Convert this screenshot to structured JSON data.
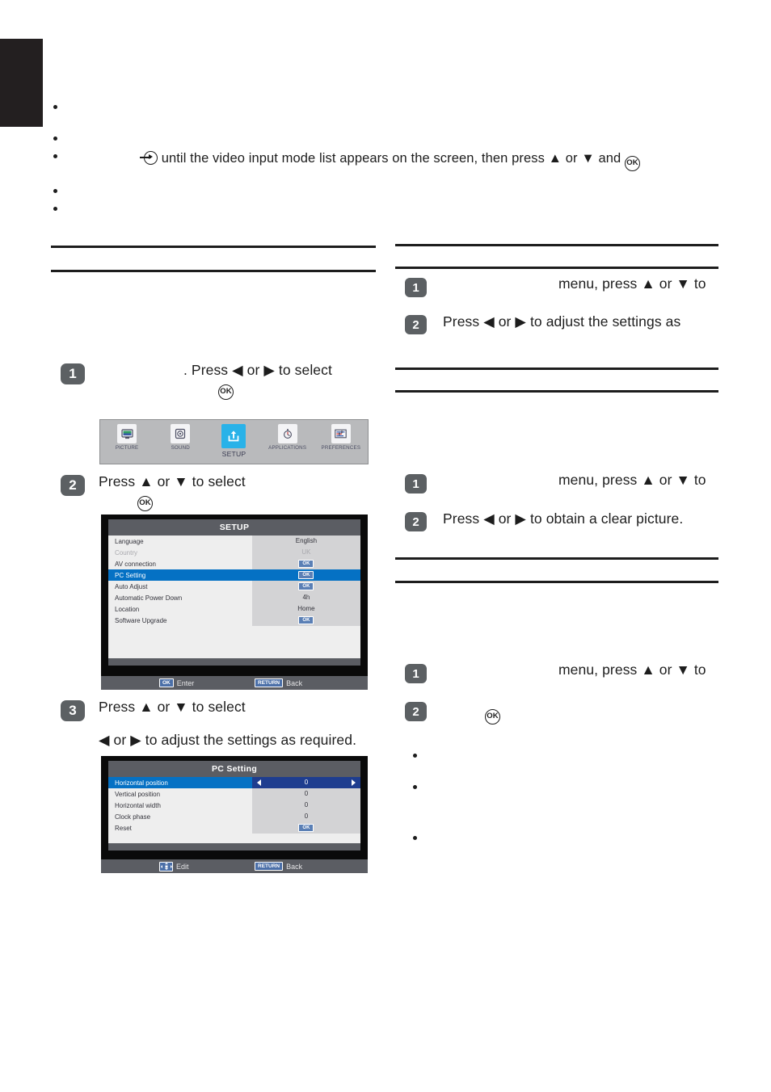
{
  "page": {
    "top_note": {
      "text_before": "until the video input mode list appears on the screen, then press ▲ or ▼ and",
      "ok_label": "OK"
    }
  },
  "left_column": {
    "steps": [
      {
        "number": "1",
        "line1": ". Press ◀ or ▶ to select",
        "line2_ok": "OK"
      },
      {
        "number": "2",
        "line1": "Press ▲ or ▼ to select",
        "line2_ok": "OK"
      },
      {
        "number": "3",
        "line1": "Press ▲ or ▼ to select",
        "line2": "◀ or ▶ to adjust the settings as required."
      }
    ],
    "icon_bar": {
      "items": [
        {
          "label": "PICTURE",
          "icon": "monitor-icon",
          "active": false
        },
        {
          "label": "SOUND",
          "icon": "speaker-icon",
          "active": false
        },
        {
          "label": "SETUP",
          "icon": "setup-upload-icon",
          "active": true
        },
        {
          "label": "APPLICATIONS",
          "icon": "stopwatch-icon",
          "active": false
        },
        {
          "label": "PREFERENCES",
          "icon": "sliders-icon",
          "active": false
        }
      ],
      "active_color": "#29b2e8"
    },
    "setup_menu": {
      "title": "SETUP",
      "rows": [
        {
          "label": "Language",
          "value": "English",
          "type": "text",
          "state": "normal"
        },
        {
          "label": "Country",
          "value": "UK",
          "type": "text",
          "state": "dim"
        },
        {
          "label": "AV connection",
          "value": "OK",
          "type": "ok",
          "state": "normal"
        },
        {
          "label": "PC Setting",
          "value": "OK",
          "type": "ok",
          "state": "selected"
        },
        {
          "label": "Auto Adjust",
          "value": "OK",
          "type": "ok",
          "state": "normal"
        },
        {
          "label": "Automatic Power Down",
          "value": "4h",
          "type": "text",
          "state": "normal"
        },
        {
          "label": "Location",
          "value": "Home",
          "type": "text",
          "state": "normal"
        },
        {
          "label": "Software Upgrade",
          "value": "OK",
          "type": "ok",
          "state": "normal"
        }
      ],
      "footer": {
        "left_key": "OK",
        "left_label": "Enter",
        "right_key": "RETURN",
        "right_label": "Back"
      }
    },
    "pc_setting_menu": {
      "title": "PC Setting",
      "rows": [
        {
          "label": "Horizontal position",
          "value": "0",
          "type": "spin",
          "state": "selected"
        },
        {
          "label": "Vertical position",
          "value": "0",
          "type": "text",
          "state": "normal"
        },
        {
          "label": "Horizontal width",
          "value": "0",
          "type": "text",
          "state": "normal"
        },
        {
          "label": "Clock phase",
          "value": "0",
          "type": "text",
          "state": "normal"
        },
        {
          "label": "Reset",
          "value": "OK",
          "type": "ok",
          "state": "normal"
        }
      ],
      "footer": {
        "left_key": "dpad-icon",
        "left_label": "Edit",
        "right_key": "RETURN",
        "right_label": "Back"
      }
    }
  },
  "right_column": {
    "block1": {
      "steps": [
        {
          "number": "1",
          "text": "menu, press ▲ or ▼ to"
        },
        {
          "number": "2",
          "text": "Press ◀ or ▶ to adjust the settings as"
        }
      ]
    },
    "block2": {
      "steps": [
        {
          "number": "1",
          "text": "menu, press ▲ or ▼ to"
        },
        {
          "number": "2",
          "text": "Press ◀ or ▶ to obtain a clear picture."
        }
      ]
    },
    "block3": {
      "steps": [
        {
          "number": "1",
          "text": "menu, press ▲ or ▼ to"
        },
        {
          "number": "2",
          "text": "",
          "ok_label": "OK"
        }
      ]
    }
  }
}
